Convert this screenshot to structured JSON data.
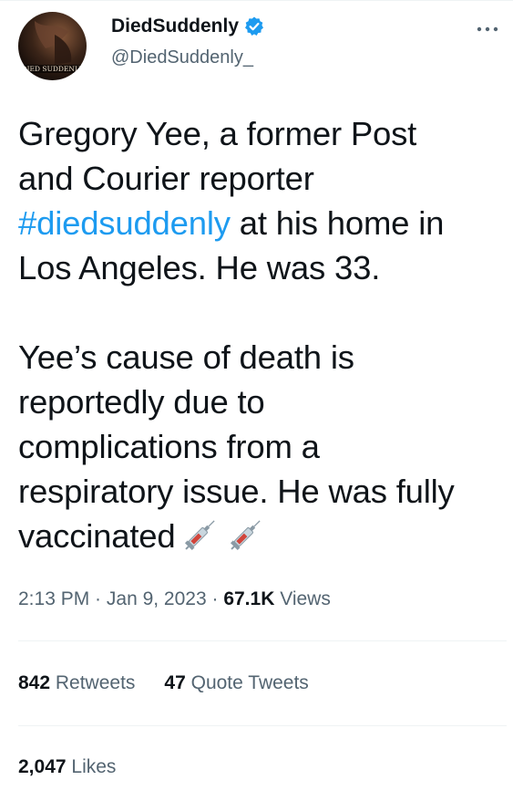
{
  "author": {
    "display_name": "DiedSuddenly",
    "handle": "@DiedSuddenly_",
    "avatar_text": "DIED SUDDENLY",
    "verified_icon": "verified-badge-icon",
    "more_icon": "more-options-icon"
  },
  "tweet": {
    "line_1": "Gregory Yee, a former Post",
    "line_2": "and Courier reporter",
    "hashtag": "#diedsuddenly",
    "line_3_rest": " at his home in",
    "line_4": "Los Angeles. He was 33.",
    "line_5": "Yee’s cause of death is",
    "line_6": "reportedly due to",
    "line_7": "complications from a",
    "line_8": "respiratory issue. He was fully",
    "line_9": "vaccinated",
    "emoji_icons": [
      "syringe-icon",
      "syringe-icon"
    ]
  },
  "meta": {
    "time": "2:13 PM",
    "sep1": " · ",
    "date": "Jan 9, 2023",
    "sep2": " · ",
    "views_count": "67.1K",
    "views_label": " Views"
  },
  "stats": {
    "retweets_count": "842",
    "retweets_label": " Retweets",
    "quotes_count": "47",
    "quotes_label": " Quote Tweets",
    "likes_count": "2,047",
    "likes_label": " Likes"
  },
  "colors": {
    "link": "#1d9bf0",
    "text_primary": "#0f1419",
    "text_secondary": "#536471",
    "divider": "#eff3f4"
  }
}
